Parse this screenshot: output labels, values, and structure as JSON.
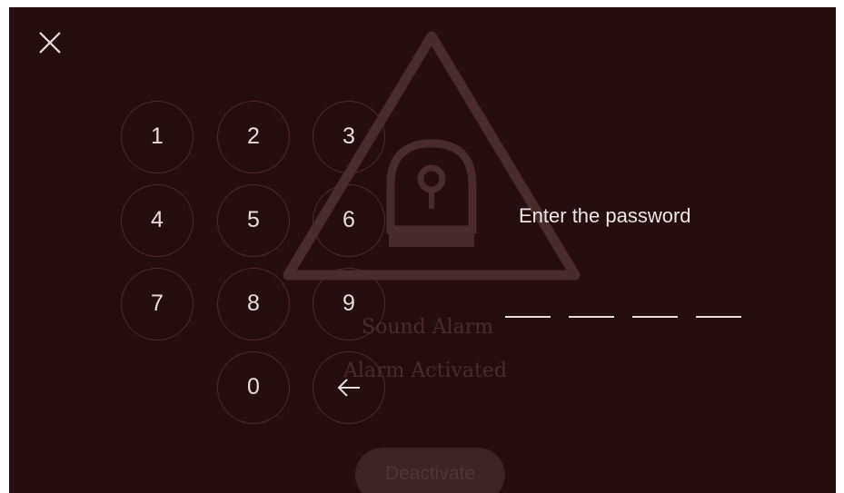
{
  "background_screen": {
    "title": "Sound Alarm",
    "status": "Alarm Activated",
    "deactivate_label": "Deactivate",
    "icon": "siren-warning-icon"
  },
  "close_icon": "close-icon",
  "keypad": {
    "keys": [
      "1",
      "2",
      "3",
      "4",
      "5",
      "6",
      "7",
      "8",
      "9",
      "0"
    ],
    "backspace_icon": "arrow-left-icon"
  },
  "password": {
    "prompt": "Enter the password",
    "length": 4,
    "entered": ""
  },
  "colors": {
    "background": "#240e10",
    "text": "#ece6e6",
    "key_border": "#4b2c2f",
    "faded": "#4a2c2e"
  }
}
